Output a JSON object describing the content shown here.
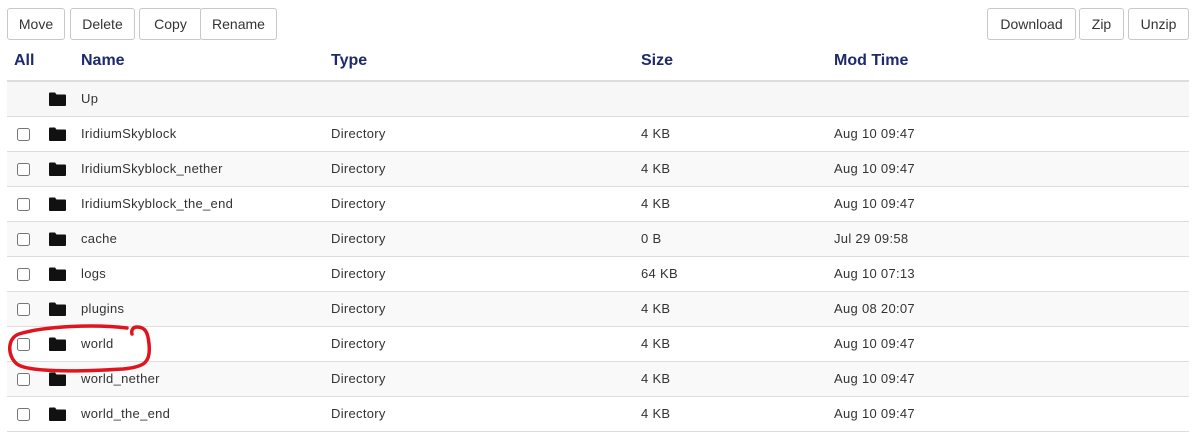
{
  "toolbar": {
    "move_label": "Move",
    "delete_label": "Delete",
    "copy_label": "Copy",
    "rename_label": "Rename",
    "download_label": "Download",
    "zip_label": "Zip",
    "unzip_label": "Unzip"
  },
  "table": {
    "columns": {
      "all": "All",
      "name": "Name",
      "type": "Type",
      "size": "Size",
      "mod_time": "Mod Time"
    },
    "up_label": "Up",
    "rows": [
      {
        "name": "IridiumSkyblock",
        "type": "Directory",
        "size": "4 KB",
        "mod_time": "Aug 10 09:47"
      },
      {
        "name": "IridiumSkyblock_nether",
        "type": "Directory",
        "size": "4 KB",
        "mod_time": "Aug 10 09:47"
      },
      {
        "name": "IridiumSkyblock_the_end",
        "type": "Directory",
        "size": "4 KB",
        "mod_time": "Aug 10 09:47"
      },
      {
        "name": "cache",
        "type": "Directory",
        "size": "0 B",
        "mod_time": "Jul 29 09:58"
      },
      {
        "name": "logs",
        "type": "Directory",
        "size": "64 KB",
        "mod_time": "Aug 10 07:13"
      },
      {
        "name": "plugins",
        "type": "Directory",
        "size": "4 KB",
        "mod_time": "Aug 08 20:07"
      },
      {
        "name": "world",
        "type": "Directory",
        "size": "4 KB",
        "mod_time": "Aug 10 09:47"
      },
      {
        "name": "world_nether",
        "type": "Directory",
        "size": "4 KB",
        "mod_time": "Aug 10 09:47"
      },
      {
        "name": "world_the_end",
        "type": "Directory",
        "size": "4 KB",
        "mod_time": "Aug 10 09:47"
      }
    ]
  },
  "icons": {
    "folder": "folder-icon"
  },
  "colors": {
    "header_text": "#1d2a6b",
    "annotation": "#e0141e"
  }
}
